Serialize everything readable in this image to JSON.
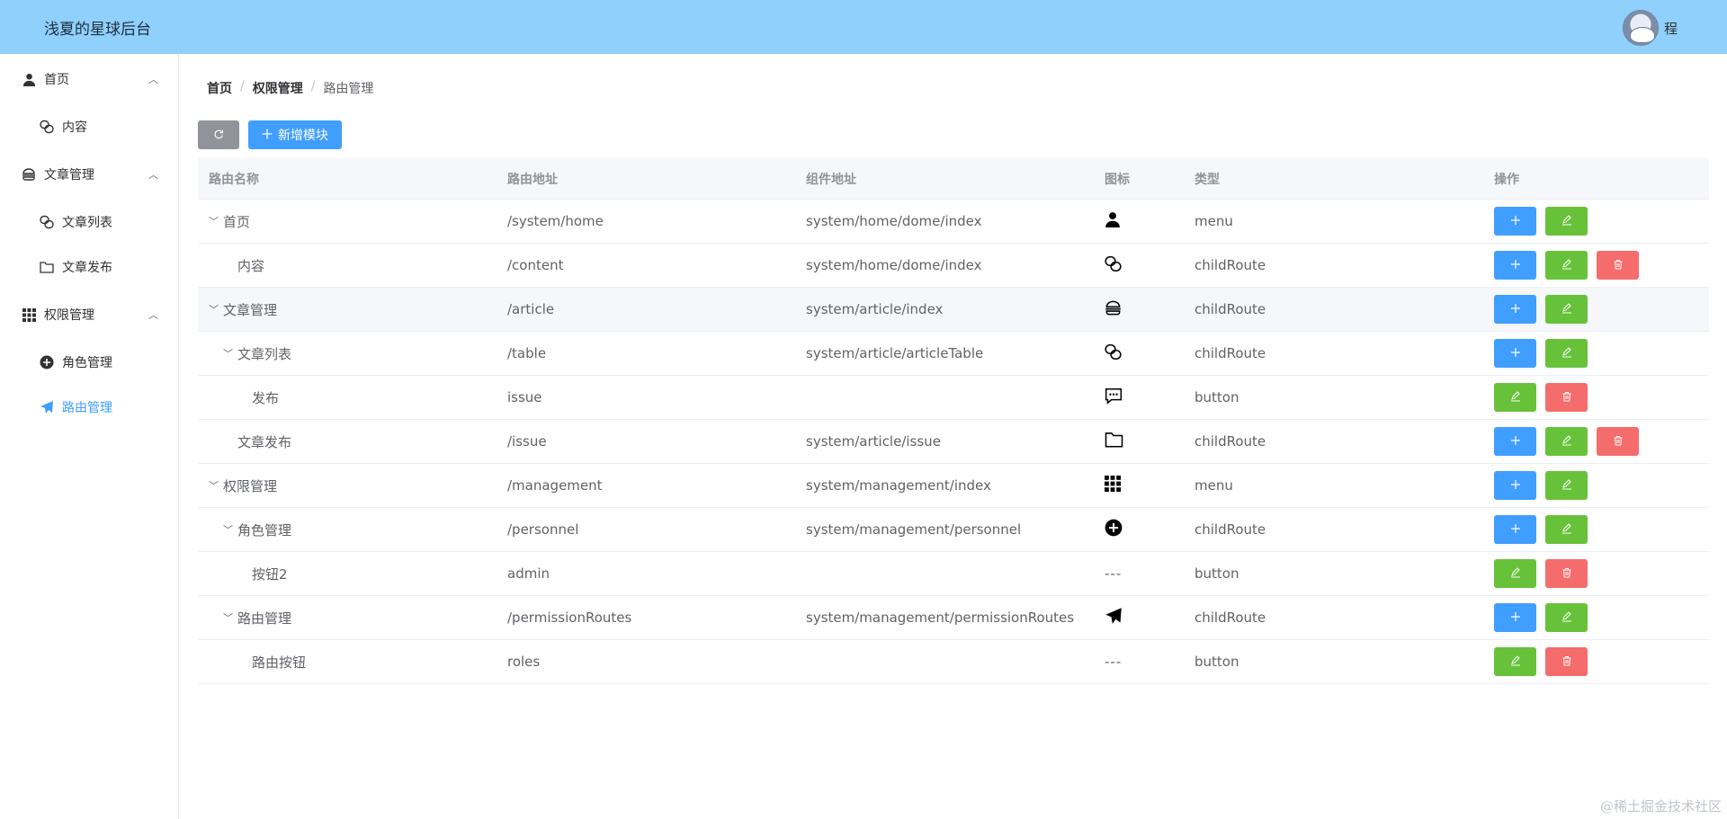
{
  "header": {
    "title": "浅夏的星球后台",
    "user_name": "程"
  },
  "sidebar": {
    "groups": [
      {
        "label": "首页",
        "icon": "user-icon",
        "items": [
          {
            "label": "内容",
            "icon": "link-icon"
          }
        ]
      },
      {
        "label": "文章管理",
        "icon": "burger-icon",
        "items": [
          {
            "label": "文章列表",
            "icon": "link-icon"
          },
          {
            "label": "文章发布",
            "icon": "folder-icon"
          }
        ]
      },
      {
        "label": "权限管理",
        "icon": "grid-icon",
        "items": [
          {
            "label": "角色管理",
            "icon": "plus-circle-icon"
          },
          {
            "label": "路由管理",
            "icon": "send-icon",
            "active": true
          }
        ]
      }
    ]
  },
  "breadcrumb": [
    "首页",
    "权限管理",
    "路由管理"
  ],
  "toolbar": {
    "add_label": "新增模块"
  },
  "table": {
    "headers": [
      "路由名称",
      "路由地址",
      "组件地址",
      "图标",
      "类型",
      "操作"
    ],
    "rows": [
      {
        "name": "首页",
        "path": "/system/home",
        "component": "system/home/dome/index",
        "icon": "user-icon",
        "type": "menu"
      },
      {
        "name": "内容",
        "path": "/content",
        "component": "system/home/dome/index",
        "icon": "link-icon",
        "type": "childRoute"
      },
      {
        "name": "文章管理",
        "path": "/article",
        "component": "system/article/index",
        "icon": "burger-icon",
        "type": "childRoute"
      },
      {
        "name": "文章列表",
        "path": "/table",
        "component": "system/article/articleTable",
        "icon": "link-icon",
        "type": "childRoute"
      },
      {
        "name": "发布",
        "path": "issue",
        "component": "",
        "icon": "message-icon",
        "type": "button"
      },
      {
        "name": "文章发布",
        "path": "/issue",
        "component": "system/article/issue",
        "icon": "folder-icon",
        "type": "childRoute"
      },
      {
        "name": "权限管理",
        "path": "/management",
        "component": "system/management/index",
        "icon": "grid-icon",
        "type": "menu"
      },
      {
        "name": "角色管理",
        "path": "/personnel",
        "component": "system/management/personnel",
        "icon": "plus-circle-icon",
        "type": "childRoute"
      },
      {
        "name": "按钮2",
        "path": "admin",
        "component": "",
        "icon_text": "---",
        "type": "button"
      },
      {
        "name": "路由管理",
        "path": "/permissionRoutes",
        "component": "system/management/permissionRoutes",
        "icon": "send-icon",
        "type": "childRoute"
      },
      {
        "name": "路由按钮",
        "path": "roles",
        "component": "",
        "icon_text": "---",
        "type": "button"
      }
    ]
  },
  "watermark": "@稀土掘金技术社区"
}
